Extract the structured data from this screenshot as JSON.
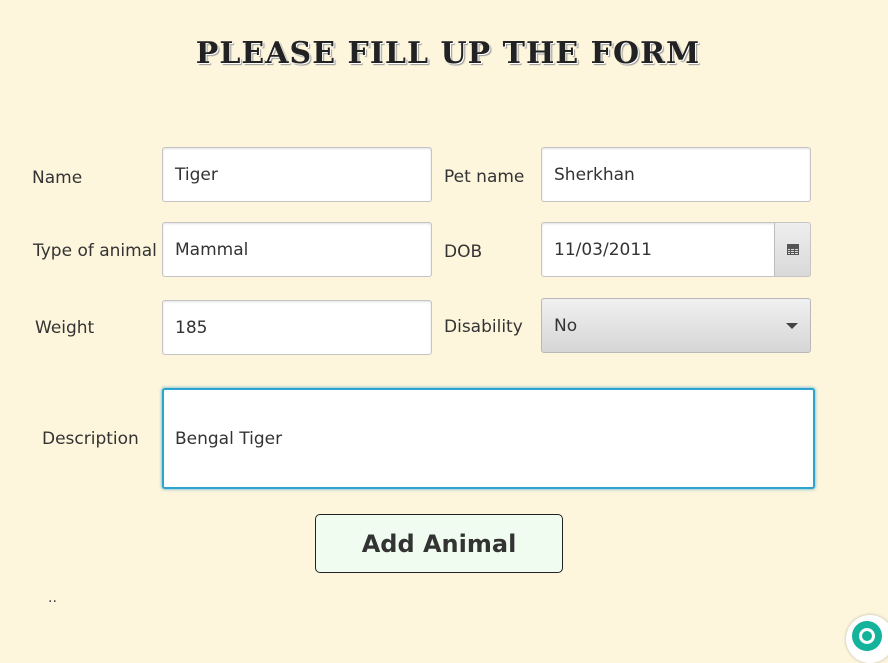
{
  "title": "PLEASE FILL UP THE FORM",
  "form": {
    "name": {
      "label": "Name",
      "value": "Tiger"
    },
    "pet_name": {
      "label": "Pet name",
      "value": "Sherkhan"
    },
    "type_of_animal": {
      "label": "Type of animal",
      "value": "Mammal"
    },
    "dob": {
      "label": "DOB",
      "value": "11/03/2011",
      "button_icon": "calendar-icon"
    },
    "weight": {
      "label": "Weight",
      "value": "185"
    },
    "disability": {
      "label": "Disability",
      "selected": "No",
      "icon": "chevron-down-icon"
    },
    "description": {
      "label": "Description",
      "value": "Bengal Tiger"
    }
  },
  "actions": {
    "add_label": "Add Animal"
  },
  "status_text": "..",
  "floating_button": {
    "icon": "assistant-icon"
  },
  "colors": {
    "background": "#fdf5dc",
    "focus_border": "#2ea3cf",
    "add_button_bg": "#effcef",
    "assistant_accent": "#14b39c"
  }
}
